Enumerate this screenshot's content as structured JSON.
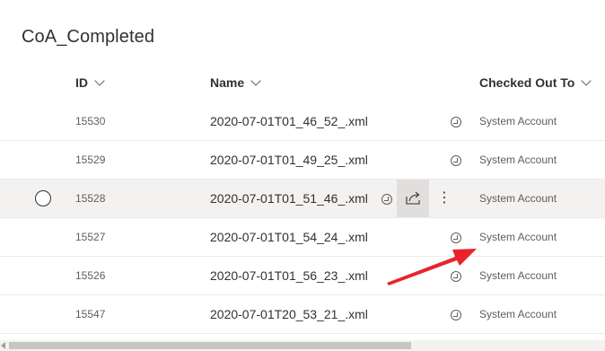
{
  "list": {
    "title": "CoA_Completed"
  },
  "columns": {
    "id": "ID",
    "name": "Name",
    "checked_out_to": "Checked Out To"
  },
  "rows": [
    {
      "id": "15530",
      "name": "2020-07-01T01_46_52_.xml",
      "checked_out_to": "System Account"
    },
    {
      "id": "15529",
      "name": "2020-07-01T01_49_25_.xml",
      "checked_out_to": "System Account"
    },
    {
      "id": "15528",
      "name": "2020-07-01T01_51_46_.xml",
      "checked_out_to": "System Account"
    },
    {
      "id": "15527",
      "name": "2020-07-01T01_54_24_.xml",
      "checked_out_to": "System Account"
    },
    {
      "id": "15526",
      "name": "2020-07-01T01_56_23_.xml",
      "checked_out_to": "System Account"
    },
    {
      "id": "15547",
      "name": "2020-07-01T20_53_21_.xml",
      "checked_out_to": "System Account"
    }
  ],
  "hovered_row_index": 2,
  "row_actions": {
    "more_glyph": "⋮"
  },
  "icons": {
    "checkout": "checked-out-icon",
    "share": "share-icon",
    "more": "more-options-icon",
    "select": "row-select-radio"
  },
  "colors": {
    "annotation_arrow": "#e8232a",
    "hover_row": "#f3f2f1",
    "share_button_bg": "#e1dfdd"
  }
}
